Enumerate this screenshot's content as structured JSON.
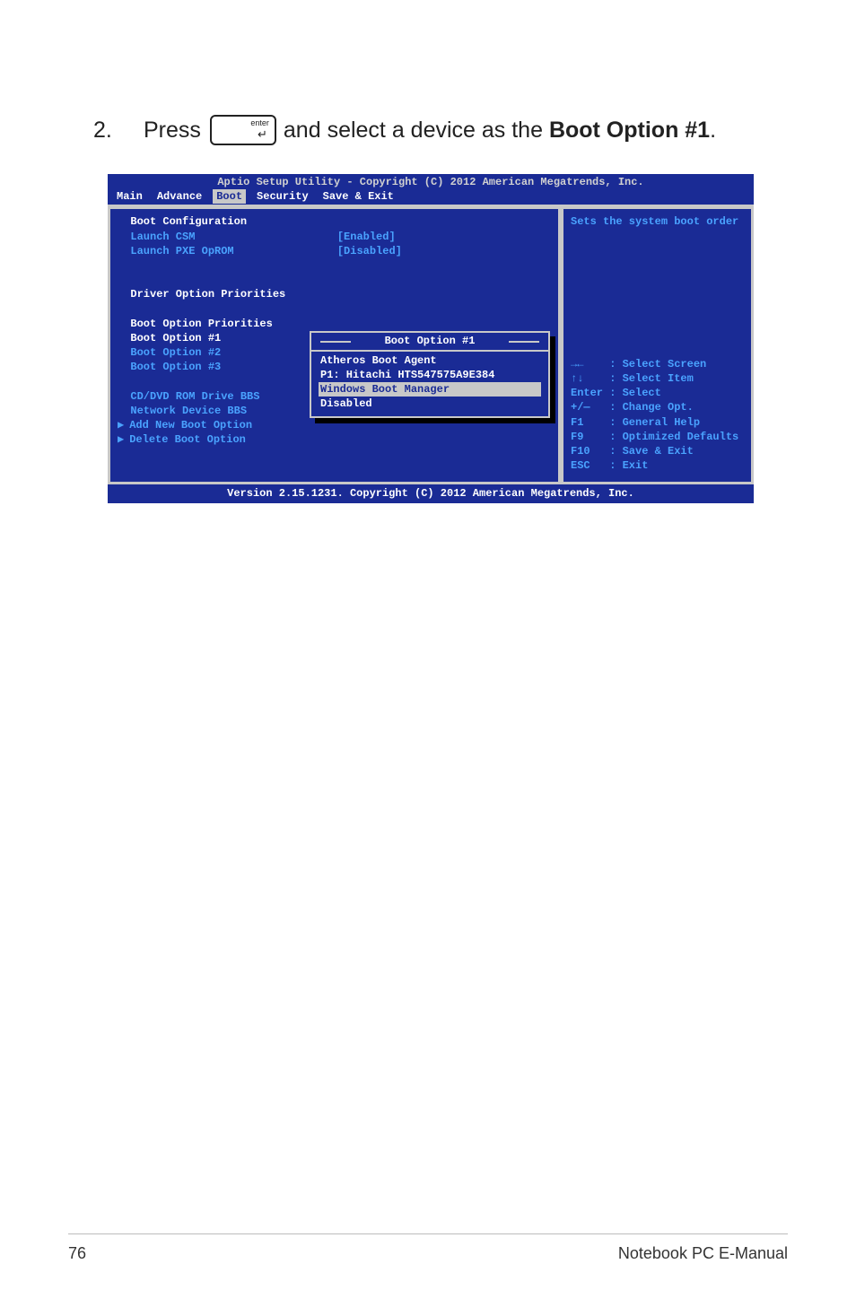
{
  "instruction": {
    "number": "2.",
    "press": "Press",
    "key_label": "enter",
    "rest_prefix": " and select a device as the ",
    "bold": "Boot Option #1",
    "rest_suffix": "."
  },
  "bios": {
    "top_line": "Aptio Setup Utility - Copyright (C) 2012 American Megatrends, Inc.",
    "menu": [
      "Main",
      "Advance",
      "Boot",
      "Security",
      "Save & Exit"
    ],
    "menu_active_index": 2,
    "left": {
      "heading": "Boot Configuration",
      "rows": [
        {
          "label": "Launch CSM",
          "value": "[Enabled]",
          "selected": false
        },
        {
          "label": "Launch PXE OpROM",
          "value": "[Disabled]",
          "selected": false
        }
      ],
      "driver_heading": "Driver Option Priorities",
      "boot_heading": "Boot Option Priorities",
      "boot_rows": [
        {
          "label": "Boot Option #1",
          "value": "[Windows Boot Manager]",
          "selected": true
        },
        {
          "label": "Boot Option #2",
          "value": "[P1: Hitachi HTS547..]",
          "selected": false
        },
        {
          "label": "Boot Option #3",
          "value": "",
          "selected": false
        }
      ],
      "extra_rows": [
        "CD/DVD ROM Drive BBS",
        "Network Device BBS"
      ],
      "action_rows": [
        "Add New Boot Option",
        "Delete Boot Option"
      ]
    },
    "popup": {
      "title": "Boot Option #1",
      "items": [
        {
          "label": "Atheros Boot Agent",
          "selected": false
        },
        {
          "label": "P1: Hitachi HTS547575A9E384",
          "selected": false
        },
        {
          "label": "Windows Boot Manager",
          "selected": true
        },
        {
          "label": "Disabled",
          "selected": false
        }
      ]
    },
    "right": {
      "help": "Sets the system boot order",
      "keys": [
        {
          "k": "→←",
          "d": ": Select Screen"
        },
        {
          "k": "↑↓",
          "d": ": Select Item"
        },
        {
          "k": "Enter",
          "d": ": Select"
        },
        {
          "k": "+/—",
          "d": ": Change Opt."
        },
        {
          "k": "F1",
          "d": ": General Help"
        },
        {
          "k": "F9",
          "d": ": Optimized Defaults"
        },
        {
          "k": "F10",
          "d": ": Save & Exit"
        },
        {
          "k": "ESC",
          "d": ": Exit"
        }
      ]
    },
    "footer": "Version 2.15.1231. Copyright (C) 2012 American Megatrends, Inc."
  },
  "page_footer": {
    "page_number": "76",
    "doc_title": "Notebook PC E-Manual"
  }
}
